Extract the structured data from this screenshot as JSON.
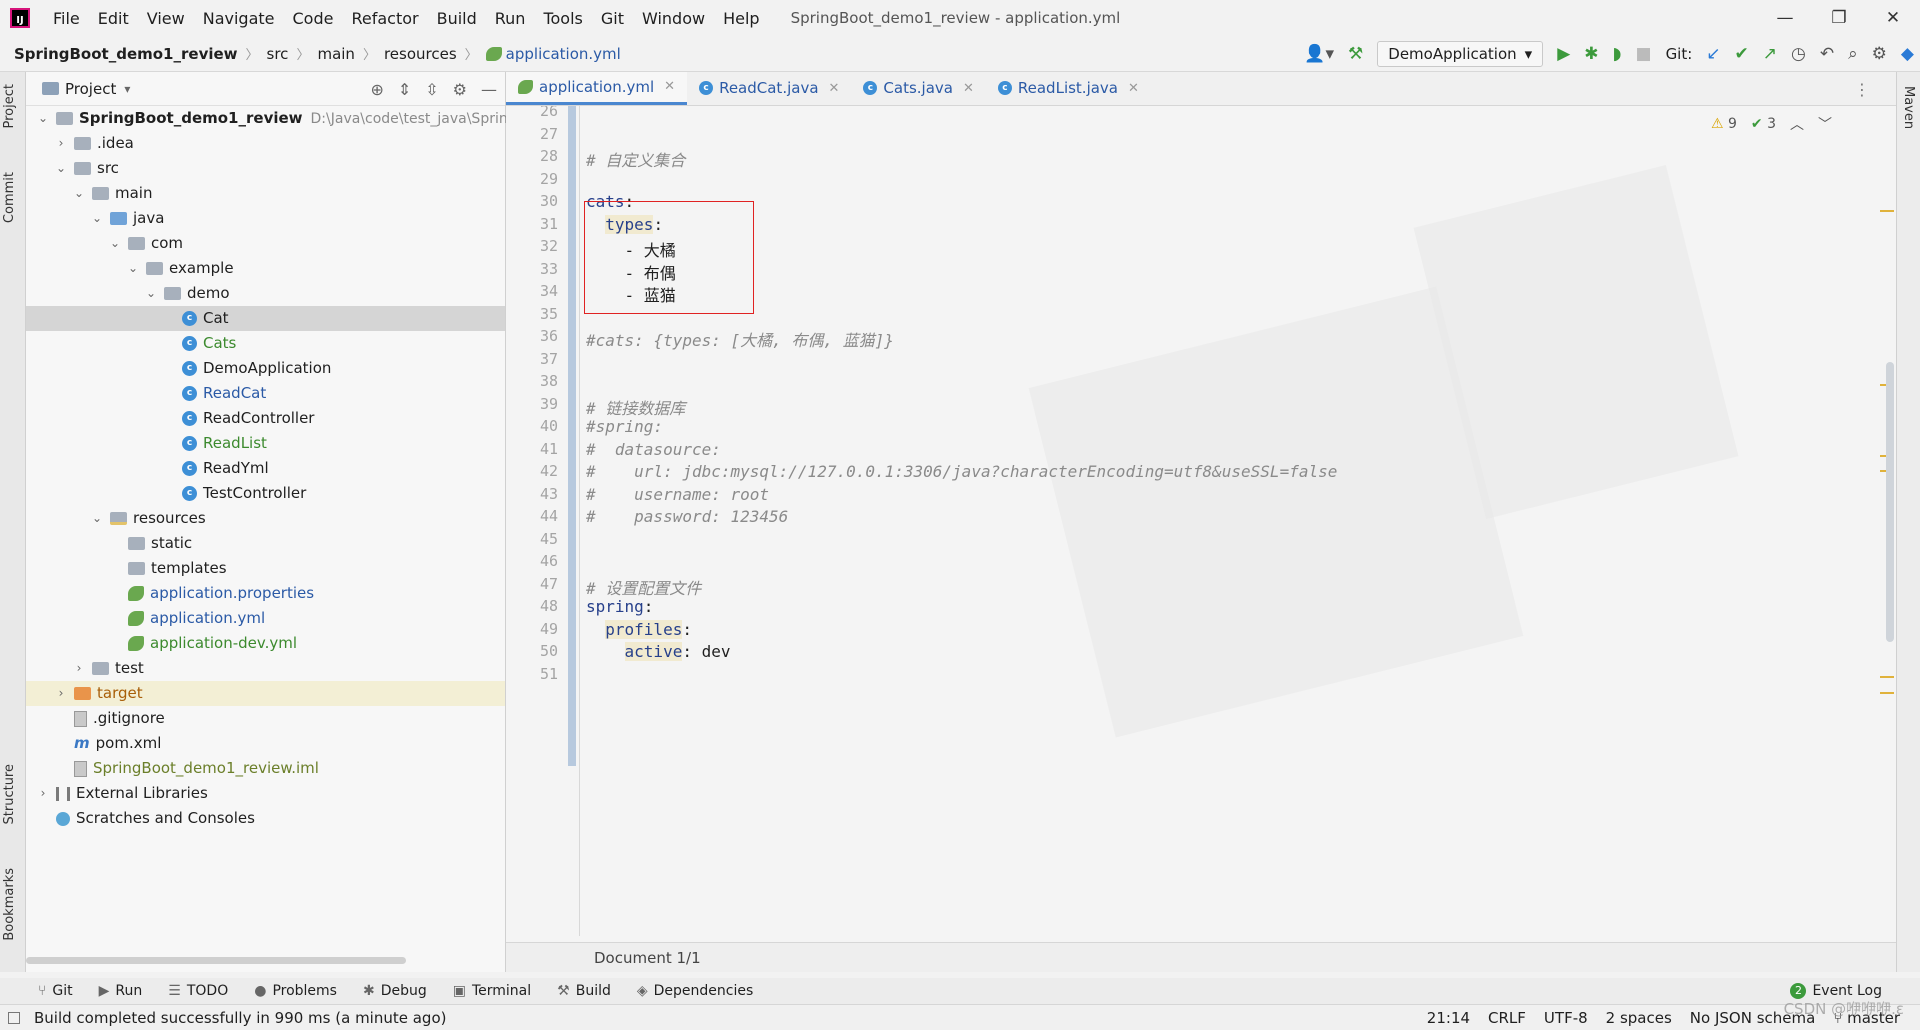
{
  "window": {
    "menu": [
      "File",
      "Edit",
      "View",
      "Navigate",
      "Code",
      "Refactor",
      "Build",
      "Run",
      "Tools",
      "Git",
      "Window",
      "Help"
    ],
    "title": "SpringBoot_demo1_review - application.yml",
    "controls": [
      "—",
      "❐",
      "✕"
    ]
  },
  "breadcrumb": [
    "SpringBoot_demo1_review",
    "src",
    "main",
    "resources",
    "application.yml"
  ],
  "toolbar": {
    "run_config": "DemoApplication",
    "git_label": "Git:"
  },
  "left_strip": [
    "Project",
    "Commit",
    "Structure",
    "Bookmarks"
  ],
  "right_strip": [
    "Maven"
  ],
  "project_panel": {
    "title": "Project",
    "tree": [
      {
        "label": "SpringBoot_demo1_review",
        "hint": "D:\\Java\\code\\test_java\\SpringB",
        "icon": "folder-icon",
        "indent": 0,
        "chev": "v",
        "style": "bold"
      },
      {
        "label": ".idea",
        "icon": "folder-icon",
        "indent": 1,
        "chev": ">"
      },
      {
        "label": "src",
        "icon": "folder-icon",
        "indent": 1,
        "chev": "v"
      },
      {
        "label": "main",
        "icon": "folder-icon",
        "indent": 2,
        "chev": "v"
      },
      {
        "label": "java",
        "icon": "source-folder-icon",
        "indent": 3,
        "chev": "v"
      },
      {
        "label": "com",
        "icon": "package-icon",
        "indent": 4,
        "chev": "v"
      },
      {
        "label": "example",
        "icon": "package-icon",
        "indent": 5,
        "chev": "v"
      },
      {
        "label": "demo",
        "icon": "package-icon",
        "indent": 6,
        "chev": "v"
      },
      {
        "label": "Cat",
        "icon": "class-icon",
        "indent": 7,
        "selected": true
      },
      {
        "label": "Cats",
        "icon": "class-icon",
        "indent": 7,
        "color": "green"
      },
      {
        "label": "DemoApplication",
        "icon": "class-icon",
        "indent": 7
      },
      {
        "label": "ReadCat",
        "icon": "class-icon",
        "indent": 7,
        "color": "blue"
      },
      {
        "label": "ReadController",
        "icon": "class-icon",
        "indent": 7
      },
      {
        "label": "ReadList",
        "icon": "class-icon",
        "indent": 7,
        "color": "green"
      },
      {
        "label": "ReadYml",
        "icon": "class-icon",
        "indent": 7
      },
      {
        "label": "TestController",
        "icon": "class-icon",
        "indent": 7
      },
      {
        "label": "resources",
        "icon": "resources-folder-icon",
        "indent": 3,
        "chev": "v"
      },
      {
        "label": "static",
        "icon": "folder-icon",
        "indent": 4
      },
      {
        "label": "templates",
        "icon": "folder-icon",
        "indent": 4
      },
      {
        "label": "application.properties",
        "icon": "spring-config-icon",
        "indent": 4,
        "color": "blue"
      },
      {
        "label": "application.yml",
        "icon": "spring-config-icon",
        "indent": 4,
        "color": "blue"
      },
      {
        "label": "application-dev.yml",
        "icon": "spring-config-icon",
        "indent": 4,
        "color": "green"
      },
      {
        "label": "test",
        "icon": "folder-icon",
        "indent": 2,
        "chev": ">"
      },
      {
        "label": "target",
        "icon": "excluded-folder-icon",
        "indent": 1,
        "chev": ">",
        "color": "orange",
        "target": true
      },
      {
        "label": ".gitignore",
        "icon": "file-icon",
        "indent": 1
      },
      {
        "label": "pom.xml",
        "icon": "maven-icon",
        "indent": 1
      },
      {
        "label": "SpringBoot_demo1_review.iml",
        "icon": "file-icon",
        "indent": 1,
        "color": "olive"
      },
      {
        "label": "External Libraries",
        "icon": "library-icon",
        "indent": 0,
        "chev": ">"
      },
      {
        "label": "Scratches and Consoles",
        "icon": "scratch-icon",
        "indent": 0
      }
    ]
  },
  "editor": {
    "tabs": [
      {
        "label": "application.yml",
        "active": true,
        "icon": "spring-config-icon"
      },
      {
        "label": "ReadCat.java",
        "active": false,
        "icon": "class-icon"
      },
      {
        "label": "Cats.java",
        "active": false,
        "icon": "class-icon"
      },
      {
        "label": "ReadList.java",
        "active": false,
        "icon": "class-icon"
      }
    ],
    "inspection": {
      "warnings": "9",
      "ok": "3"
    },
    "lines": [
      {
        "n": "26",
        "parts": []
      },
      {
        "n": "27",
        "parts": []
      },
      {
        "n": "28",
        "parts": [
          {
            "t": "# 自定义集合",
            "c": "cmt"
          }
        ]
      },
      {
        "n": "29",
        "parts": []
      },
      {
        "n": "30",
        "parts": [
          {
            "t": "cats",
            "c": "key"
          },
          {
            "t": ":",
            "c": "val"
          }
        ]
      },
      {
        "n": "31",
        "parts": [
          {
            "t": "  ",
            "c": "val"
          },
          {
            "t": "types",
            "c": "key-hl"
          },
          {
            "t": ":",
            "c": "val"
          }
        ]
      },
      {
        "n": "32",
        "parts": [
          {
            "t": "    - 大橘",
            "c": "val"
          }
        ]
      },
      {
        "n": "33",
        "parts": [
          {
            "t": "    - 布偶",
            "c": "val"
          }
        ]
      },
      {
        "n": "34",
        "parts": [
          {
            "t": "    - 蓝猫",
            "c": "val"
          }
        ]
      },
      {
        "n": "35",
        "parts": []
      },
      {
        "n": "36",
        "parts": [
          {
            "t": "#cats: {types: [大橘, 布偶, 蓝猫]}",
            "c": "cmt"
          }
        ]
      },
      {
        "n": "37",
        "parts": []
      },
      {
        "n": "38",
        "parts": []
      },
      {
        "n": "39",
        "parts": [
          {
            "t": "# 链接数据库",
            "c": "cmt"
          }
        ]
      },
      {
        "n": "40",
        "parts": [
          {
            "t": "#spring:",
            "c": "cmt"
          }
        ]
      },
      {
        "n": "41",
        "parts": [
          {
            "t": "#  datasource:",
            "c": "cmt"
          }
        ]
      },
      {
        "n": "42",
        "parts": [
          {
            "t": "#    url: jdbc:mysql://127.0.0.1:3306/java?characterEncoding=utf8&useSSL=false",
            "c": "cmt"
          }
        ]
      },
      {
        "n": "43",
        "parts": [
          {
            "t": "#    username: root",
            "c": "cmt"
          }
        ]
      },
      {
        "n": "44",
        "parts": [
          {
            "t": "#    password: 123456",
            "c": "cmt"
          }
        ]
      },
      {
        "n": "45",
        "parts": []
      },
      {
        "n": "46",
        "parts": []
      },
      {
        "n": "47",
        "parts": [
          {
            "t": "# 设置配置文件",
            "c": "cmt"
          }
        ]
      },
      {
        "n": "48",
        "parts": [
          {
            "t": "spring",
            "c": "key"
          },
          {
            "t": ":",
            "c": "val"
          }
        ]
      },
      {
        "n": "49",
        "parts": [
          {
            "t": "  ",
            "c": "val"
          },
          {
            "t": "profiles",
            "c": "key-hl"
          },
          {
            "t": ":",
            "c": "val"
          }
        ]
      },
      {
        "n": "50",
        "parts": [
          {
            "t": "    ",
            "c": "val"
          },
          {
            "t": "active",
            "c": "key-hl"
          },
          {
            "t": ": dev",
            "c": "val"
          }
        ]
      },
      {
        "n": "51",
        "parts": []
      }
    ],
    "footer": "Document 1/1"
  },
  "tool_windows": [
    {
      "label": "Git",
      "icon": "git-icon",
      "glyph": "⑂"
    },
    {
      "label": "Run",
      "icon": "run-icon",
      "glyph": "▶"
    },
    {
      "label": "TODO",
      "icon": "todo-icon",
      "glyph": "☰"
    },
    {
      "label": "Problems",
      "icon": "problems-icon",
      "glyph": "●"
    },
    {
      "label": "Debug",
      "icon": "debug-icon",
      "glyph": "✱"
    },
    {
      "label": "Terminal",
      "icon": "terminal-icon",
      "glyph": "▣"
    },
    {
      "label": "Build",
      "icon": "build-icon",
      "glyph": "⚒"
    },
    {
      "label": "Dependencies",
      "icon": "dependencies-icon",
      "glyph": "◈"
    }
  ],
  "event_log": {
    "label": "Event Log",
    "count": "2"
  },
  "status": {
    "message": "Build completed successfully in 990 ms (a minute ago)",
    "position": "21:14",
    "line_sep": "CRLF",
    "encoding": "UTF-8",
    "indent": "2 spaces",
    "schema": "No JSON schema",
    "branch": "master"
  },
  "watermark": "CSDN @咿咿咿.ε"
}
